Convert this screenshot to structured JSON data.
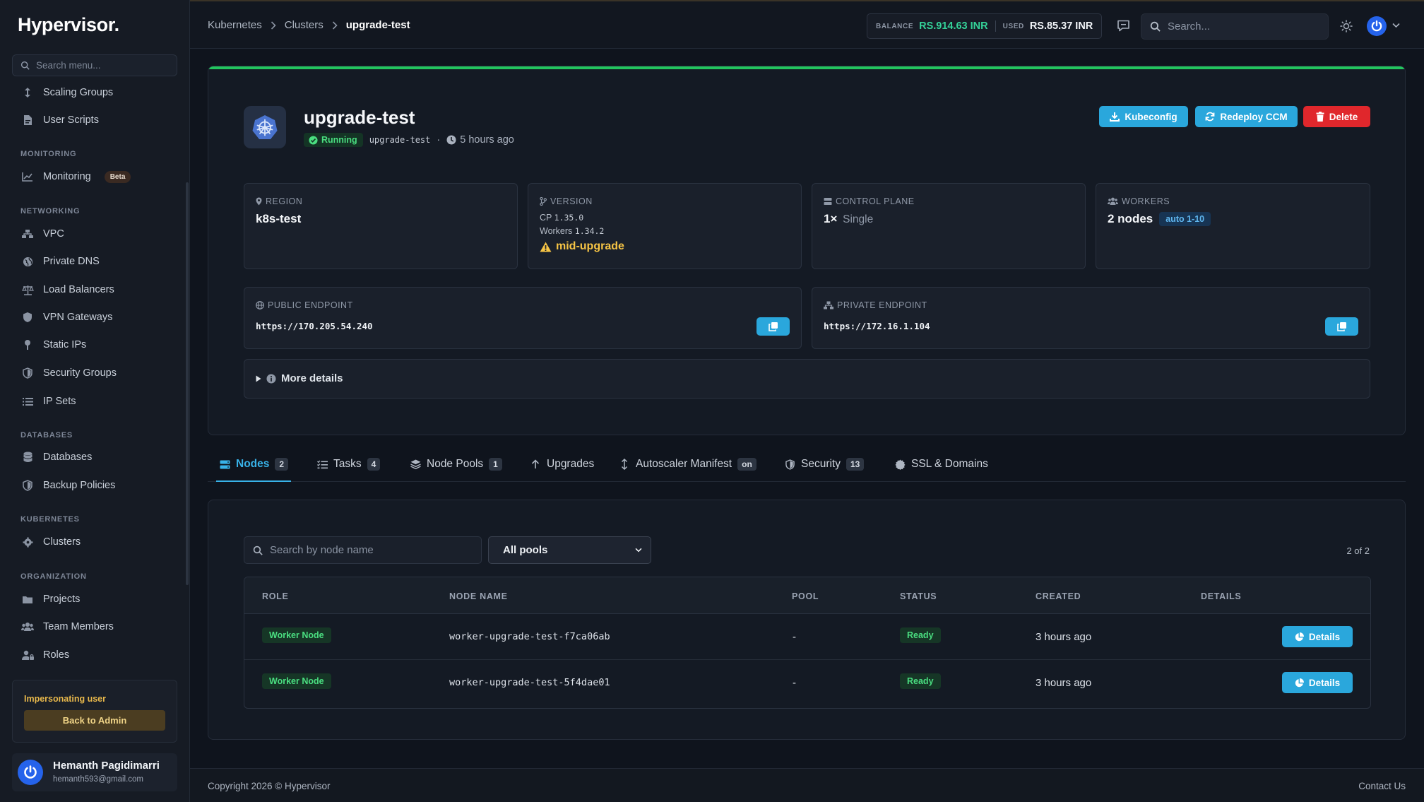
{
  "app": {
    "logo": "Hypervisor."
  },
  "sidebar": {
    "search_placeholder": "Search menu...",
    "items_top": [
      {
        "label": "Scaling Groups",
        "icon": "arrows-vertical-icon"
      },
      {
        "label": "User Scripts",
        "icon": "file-code-icon"
      }
    ],
    "sections": {
      "monitoring": "MONITORING",
      "networking": "NETWORKING",
      "databases": "DATABASES",
      "kubernetes": "KUBERNETES",
      "organization": "ORGANIZATION"
    },
    "monitoring": {
      "label": "Monitoring",
      "badge": "Beta"
    },
    "networking": [
      "VPC",
      "Private DNS",
      "Load Balancers",
      "VPN Gateways",
      "Static IPs",
      "Security Groups",
      "IP Sets"
    ],
    "databases": [
      "Databases",
      "Backup Policies"
    ],
    "kubernetes": [
      "Clusters"
    ],
    "organization": [
      "Projects",
      "Team Members",
      "Roles"
    ],
    "impersonation": {
      "title": "Impersonating user",
      "button": "Back to Admin"
    },
    "user": {
      "name": "Hemanth Pagidimarri",
      "email": "hemanth593@gmail.com"
    }
  },
  "topbar": {
    "breadcrumbs": [
      "Kubernetes",
      "Clusters",
      "upgrade-test"
    ],
    "balance_label": "BALANCE",
    "balance_value": "RS.914.63 INR",
    "used_label": "USED",
    "used_value": "RS.85.37 INR",
    "search_placeholder": "Search..."
  },
  "cluster": {
    "name": "upgrade-test",
    "status": "Running",
    "slug": "upgrade-test",
    "separator": "·",
    "age": "5 hours ago",
    "buttons": {
      "kubeconfig": "Kubeconfig",
      "redeploy": "Redeploy CCM",
      "delete": "Delete"
    },
    "region": {
      "label": "REGION",
      "value": "k8s-test"
    },
    "version": {
      "label": "VERSION",
      "cp_label": "CP",
      "cp_value": "1.35.0",
      "workers_label": "Workers",
      "workers_value": "1.34.2",
      "warning": "mid-upgrade"
    },
    "control_plane": {
      "label": "CONTROL PLANE",
      "count": "1×",
      "mode": "Single"
    },
    "workers": {
      "label": "WORKERS",
      "value": "2 nodes",
      "badge": "auto 1-10"
    },
    "public_endpoint": {
      "label": "PUBLIC ENDPOINT",
      "value": "https://170.205.54.240"
    },
    "private_endpoint": {
      "label": "PRIVATE ENDPOINT",
      "value": "https://172.16.1.104"
    },
    "more_details": "More details"
  },
  "tabs": [
    {
      "label": "Nodes",
      "count": "2"
    },
    {
      "label": "Tasks",
      "count": "4"
    },
    {
      "label": "Node Pools",
      "count": "1"
    },
    {
      "label": "Upgrades",
      "count": ""
    },
    {
      "label": "Autoscaler Manifest",
      "count": "on"
    },
    {
      "label": "Security",
      "count": "13"
    },
    {
      "label": "SSL & Domains",
      "count": ""
    }
  ],
  "nodes": {
    "search_placeholder": "Search by node name",
    "pool_filter": "All pools",
    "result_count": "2 of 2",
    "columns": [
      "ROLE",
      "NODE NAME",
      "POOL",
      "STATUS",
      "CREATED",
      "DETAILS"
    ],
    "rows": [
      {
        "role": "Worker Node",
        "name": "worker-upgrade-test-f7ca06ab",
        "pool": "-",
        "status": "Ready",
        "created": "3 hours ago",
        "details": "Details"
      },
      {
        "role": "Worker Node",
        "name": "worker-upgrade-test-5f4dae01",
        "pool": "-",
        "status": "Ready",
        "created": "3 hours ago",
        "details": "Details"
      }
    ]
  },
  "footer": {
    "copyright": "Copyright 2026 © Hypervisor",
    "contact": "Contact Us"
  },
  "colors": {
    "accent": "#2aa7dc",
    "success": "#22c55e",
    "danger": "#e0272c",
    "warning": "#f6c445"
  }
}
